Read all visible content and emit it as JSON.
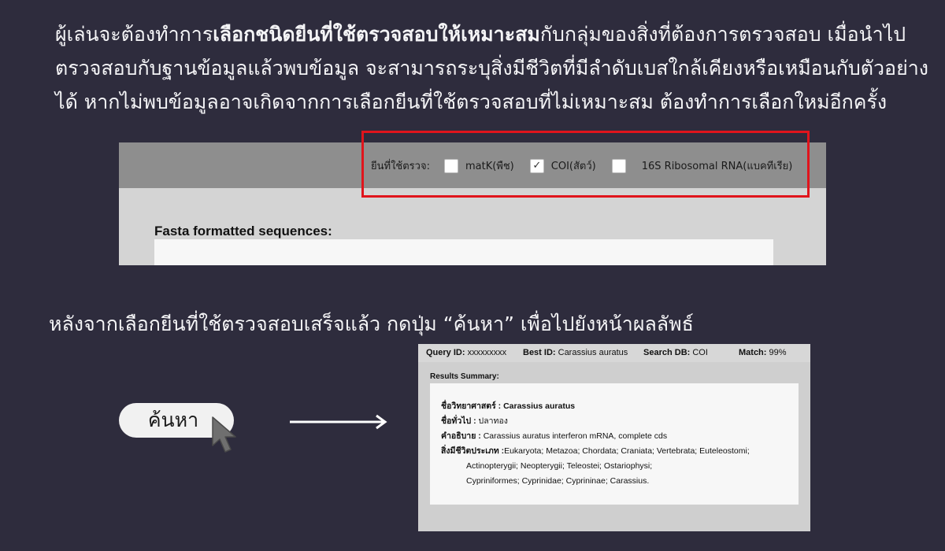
{
  "intro": {
    "line1_pre": "ผู้เล่นจะต้องทำการ",
    "line1_bold": "เลือกชนิดยีนที่ใช้ตรวจสอบให้เหมาะสม",
    "line1_post": "กับกลุ่มของสิ่งที่ต้องการตรวจสอบ  เมื่อนำไป",
    "line2": "ตรวจสอบกับฐานข้อมูลแล้วพบข้อมูล  จะสามารถระบุสิ่งมีชีวิตที่มีลำดับเบสใกล้เคียงหรือเหมือนกับตัวอย่าง",
    "line3": "ได้  หากไม่พบข้อมูลอาจเกิดจากการเลือกยีนที่ใช้ตรวจสอบที่ไม่เหมาะสม  ต้องทำการเลือกใหม่อีกครั้ง"
  },
  "gene_selector": {
    "label": "ยีนที่ใช้ตรวจ:",
    "options": [
      {
        "label": "matK(พืช)",
        "checked": false
      },
      {
        "label": "COI(สัตว์)",
        "checked": true
      },
      {
        "label": "16S  Ribosomal  RNA(แบคทีเรีย)",
        "checked": false
      }
    ],
    "check_mark": "✓"
  },
  "fasta": {
    "label": "Fasta formatted sequences:",
    "value": ""
  },
  "step2_text": "หลังจากเลือกยีนที่ใช้ตรวจสอบเสร็จแล้ว  กดปุ่ม  “ค้นหา”  เพื่อไปยังหน้าผลลัพธ์",
  "search_button": {
    "label": "ค้นหา"
  },
  "result_header": {
    "query_label": "Query ID:",
    "query_value": "xxxxxxxxx",
    "best_label": "Best ID:",
    "best_value": "Carassius auratus",
    "db_label": "Search DB:",
    "db_value": "COI",
    "match_label": "Match:",
    "match_value": "99%"
  },
  "results": {
    "summary_label": "Results Summary:",
    "sci_name_label": "ชื่อวิทยาศาสตร์ :",
    "sci_name_value": "Carassius auratus",
    "common_name_label": "ชื่อทั่วไป :",
    "common_name_value": "ปลาทอง",
    "desc_label": "คำอธิบาย :",
    "desc_value": "Carassius auratus interferon mRNA, complete cds",
    "taxonomy_label": "สิ่งมีชีวิตประเภท :",
    "taxonomy_line1": "Eukaryota; Metazoa; Chordata; Craniata; Vertebrata; Euteleostomi;",
    "taxonomy_line2": "Actinopterygii; Neopterygii; Teleostei; Ostariophysi;",
    "taxonomy_line3": "Cypriniformes; Cyprinidae; Cyprininae; Carassius."
  },
  "colors": {
    "background": "#2e2c3d",
    "highlight_frame": "#e0141c"
  },
  "icons": {
    "cursor": "cursor-arrow-icon",
    "arrow": "right-arrow-icon",
    "check": "check-icon"
  }
}
